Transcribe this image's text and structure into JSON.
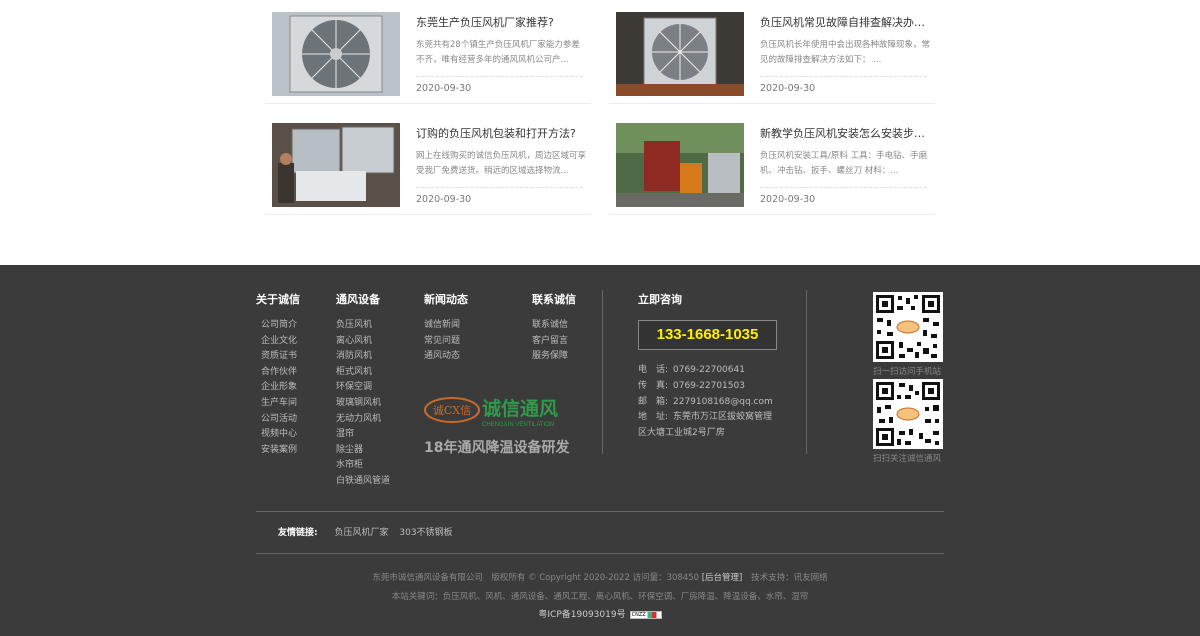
{
  "news": [
    {
      "title": "东莞生产负压风机厂家推荐?",
      "summary": "东莞共有28个镇生产负压风机厂家能力参差不齐，唯有经营多年的通风风机公司产...",
      "date": "2020-09-30"
    },
    {
      "title": "负压风机常见故障自排查解决办法?",
      "summary": "负压风机长年使用中会出现各种故障现象，常见的故障排查解决方法如下：  ...",
      "date": "2020-09-30"
    },
    {
      "title": "订购的负压风机包装和打开方法?",
      "summary": "网上在线购买的诚信负压风机，周边区域可享受我厂免费送货。稍远的区域选择物流...",
      "date": "2020-09-30"
    },
    {
      "title": "新教学负压风机安装怎么安装步骤有...",
      "summary": "负压风机安装工具/原料 工具：手电钻、手磨机、冲击钻、扳手、螺丝刀 材料：...",
      "date": "2020-09-30"
    }
  ],
  "footer": {
    "about": {
      "title": "关于诚信",
      "items": [
        "公司简介",
        "企业文化",
        "资质证书",
        "合作伙伴",
        "企业形象",
        "生产车间",
        "公司活动",
        "视频中心",
        "安装案例"
      ]
    },
    "products": {
      "title": "通风设备",
      "items": [
        "负压风机",
        "离心风机",
        "消防风机",
        "柜式风机",
        "环保空调",
        "玻璃钢风机",
        "无动力风机",
        "湿帘",
        "除尘器",
        "水帘柜",
        "白铁通风管道"
      ]
    },
    "news": {
      "title": "新闻动态",
      "items": [
        "诚信新闻",
        "常见问题",
        "通风动态"
      ]
    },
    "contact_us": {
      "title": "联系诚信",
      "items": [
        "联系诚信",
        "客户留言",
        "服务保障"
      ]
    },
    "logo": {
      "text": "诚信通风",
      "sub": "CHENGXIN VENTILATION",
      "badge": "诚CX信"
    },
    "slogan": "18年通风降温设备研发",
    "consult": {
      "title": "立即咨询",
      "hotline": "133-1668-1035",
      "rows": [
        {
          "k": "电　话:",
          "v": "0769-22700641"
        },
        {
          "k": "传　真:",
          "v": "0769-22701503"
        },
        {
          "k": "邮　箱:",
          "v": "2279108168@qq.com"
        },
        {
          "k": "地　址:",
          "v": "东莞市万江区拔蛟窝管理"
        },
        {
          "k": "",
          "v": "区大塘工业城2号厂房"
        }
      ]
    },
    "qr_mobile_caption": "扫一扫访问手机站",
    "qr_wechat_caption": "扫扫关注诚信通风",
    "links_label": "友情链接:",
    "links": [
      "负压风机厂家",
      "303不锈钢板"
    ],
    "copyright_pre": "东莞市诚信通风设备有限公司　版权所有 © Copyright 2020-2022 访问量：308450",
    "admin": "[后台管理]",
    "support": "技术支持：讯友网络",
    "keywords": "本站关键词：负压风机、风机、通风设备、通风工程、离心风机、环保空调、厂房降温、降温设备、水帘、湿帘",
    "icp": "粤ICP备19093019号",
    "cnzz": "CNZZ"
  }
}
